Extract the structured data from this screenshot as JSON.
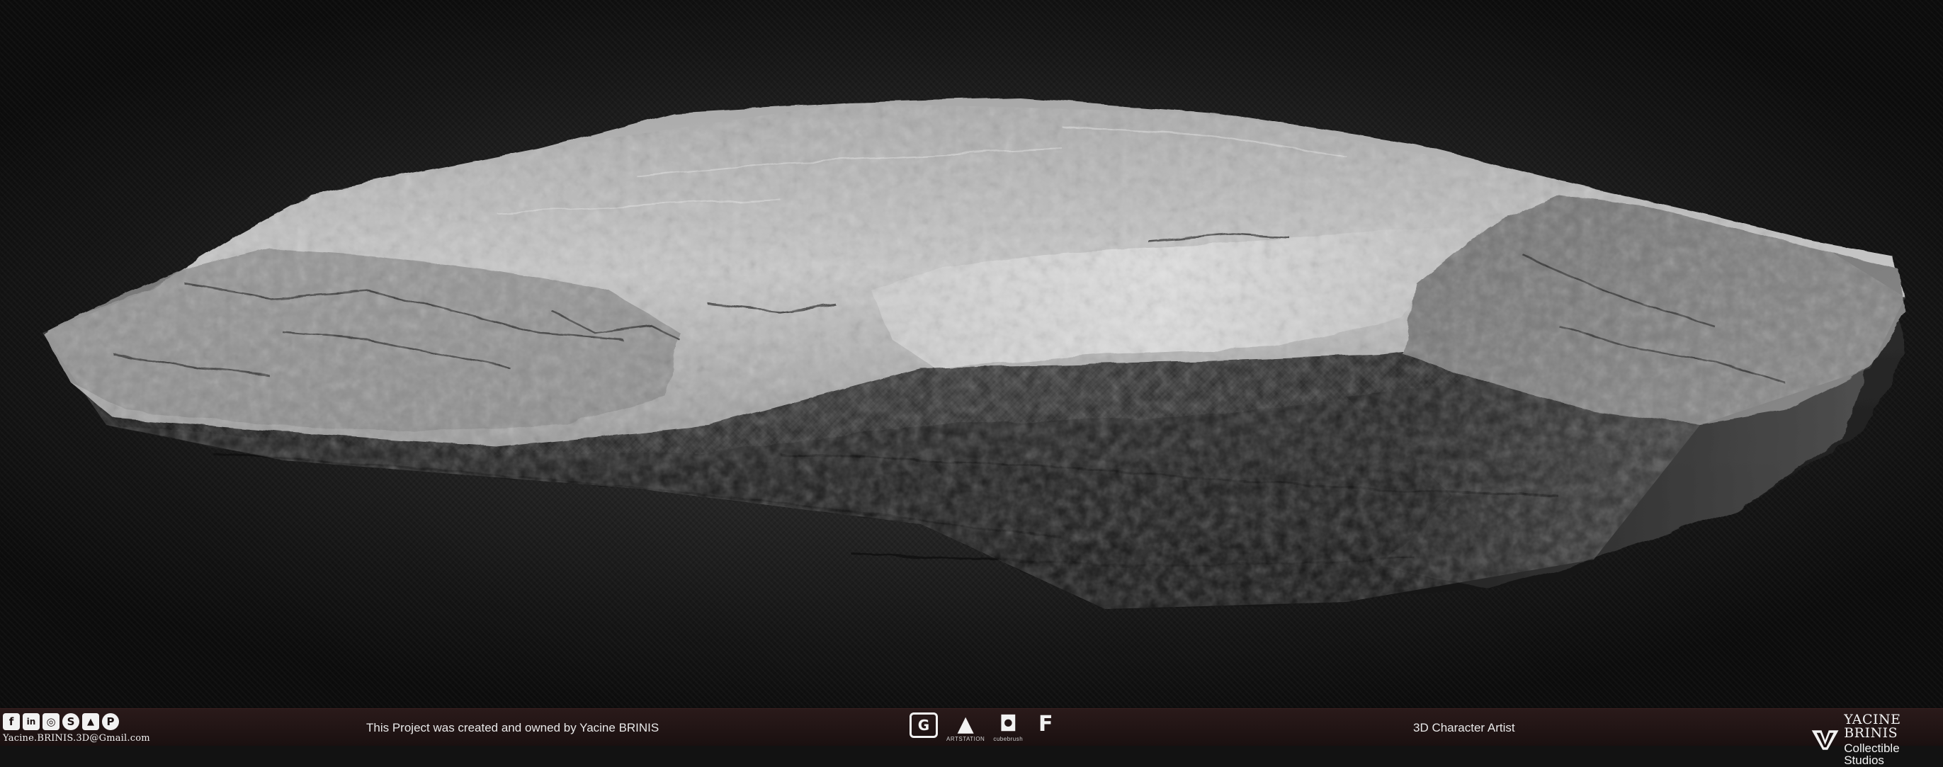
{
  "footer": {
    "social_icons": [
      "facebook-icon",
      "linkedin-icon",
      "instagram-icon",
      "skype-icon",
      "artstation-icon",
      "pinterest-icon"
    ],
    "social_glyphs": [
      "f",
      "in",
      "◎",
      "S",
      "▲",
      "P"
    ],
    "email": "Yacine.BRINIS.3D@Gmail.com",
    "credit": "This Project was created and owned by Yacine BRINIS",
    "logos": [
      {
        "icon": "gumroad-icon",
        "glyph": "G",
        "caption": ""
      },
      {
        "icon": "artstation-icon",
        "glyph": "▲",
        "caption": "ARTSTATION"
      },
      {
        "icon": "cubebrush-icon",
        "glyph": "◘",
        "caption": "cubebrush"
      },
      {
        "icon": "flippednormals-icon",
        "glyph": "F",
        "caption": ""
      }
    ],
    "role": "3D Character Artist",
    "studio_name": "YACINE BRINIS",
    "studio_sub": "Collectible Studios"
  },
  "colors": {
    "background": "#121212",
    "footer": "#1a1010",
    "rock_light": "#d8d8d8",
    "rock_dark": "#1e1e1e"
  }
}
